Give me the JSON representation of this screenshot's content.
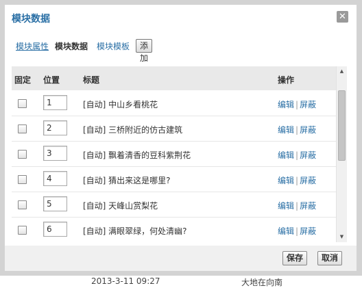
{
  "dialog": {
    "title": "模块数据",
    "close_icon": "✕"
  },
  "tabs": {
    "props": "模块属性",
    "data": "模块数据",
    "template": "模块模板",
    "add_button": "添加"
  },
  "table": {
    "headers": {
      "fixed": "固定",
      "position": "位置",
      "title": "标题",
      "action": "操作"
    },
    "rows": [
      {
        "position": "1",
        "title": "[自动] 中山乡看桃花",
        "edit": "编辑",
        "sep": "|",
        "block": "屏蔽"
      },
      {
        "position": "2",
        "title": "[自动] 三桥附近的仿古建筑",
        "edit": "编辑",
        "sep": "|",
        "block": "屏蔽"
      },
      {
        "position": "3",
        "title": "[自动] 飘着清香的豆科紫荆花",
        "edit": "编辑",
        "sep": "|",
        "block": "屏蔽"
      },
      {
        "position": "4",
        "title": "[自动] 猜出来这是哪里?",
        "edit": "编辑",
        "sep": "|",
        "block": "屏蔽"
      },
      {
        "position": "5",
        "title": "[自动] 天峰山赏梨花",
        "edit": "编辑",
        "sep": "|",
        "block": "屏蔽"
      },
      {
        "position": "6",
        "title": "[自动] 满眼翠绿，何处清幽?",
        "edit": "编辑",
        "sep": "|",
        "block": "屏蔽"
      }
    ]
  },
  "footer": {
    "save": "保存",
    "cancel": "取消"
  },
  "background": {
    "date": "2013-3-11 09:27",
    "right_text": "大地在向南"
  },
  "colors": {
    "link": "#2a6fa5",
    "frame": "#d3d3d3",
    "header_bg": "#e9e9e9"
  }
}
